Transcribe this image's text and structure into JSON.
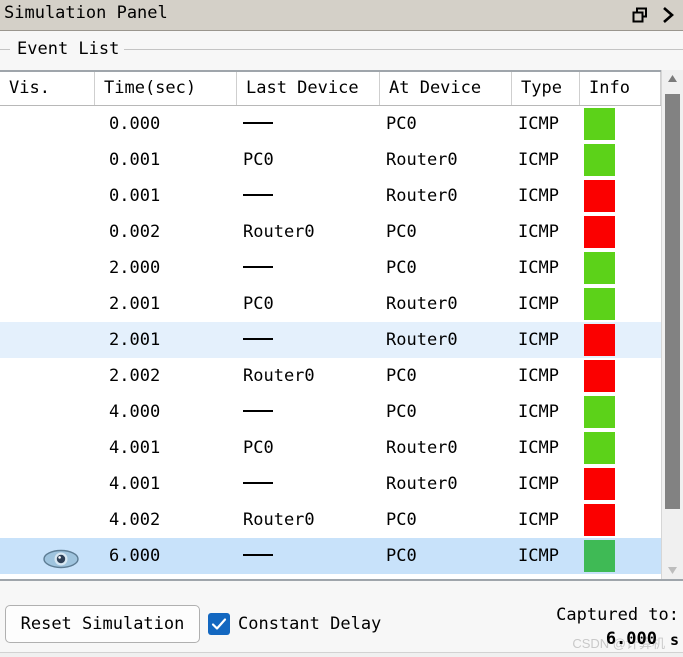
{
  "window": {
    "title": "Simulation Panel",
    "restore_icon": "restore-window-icon",
    "chevron_icon": "chevron-right-icon"
  },
  "group": {
    "legend": "Event List"
  },
  "table": {
    "columns": [
      {
        "key": "vis",
        "label": "Vis."
      },
      {
        "key": "time",
        "label": "Time(sec)"
      },
      {
        "key": "last",
        "label": "Last Device"
      },
      {
        "key": "at",
        "label": "At Device"
      },
      {
        "key": "type",
        "label": "Type"
      },
      {
        "key": "info",
        "label": "Info"
      }
    ],
    "rows": [
      {
        "vis": "",
        "time": "0.000",
        "last": "—",
        "at": "PC0",
        "type": "ICMP",
        "info_color": "#5CD219",
        "selected": "none"
      },
      {
        "vis": "",
        "time": "0.001",
        "last": "PC0",
        "at": "Router0",
        "type": "ICMP",
        "info_color": "#5CD219",
        "selected": "none"
      },
      {
        "vis": "",
        "time": "0.001",
        "last": "—",
        "at": "Router0",
        "type": "ICMP",
        "info_color": "#FB0000",
        "selected": "none"
      },
      {
        "vis": "",
        "time": "0.002",
        "last": "Router0",
        "at": "PC0",
        "type": "ICMP",
        "info_color": "#FB0000",
        "selected": "none"
      },
      {
        "vis": "",
        "time": "2.000",
        "last": "—",
        "at": "PC0",
        "type": "ICMP",
        "info_color": "#5CD219",
        "selected": "none"
      },
      {
        "vis": "",
        "time": "2.001",
        "last": "PC0",
        "at": "Router0",
        "type": "ICMP",
        "info_color": "#5CD219",
        "selected": "none"
      },
      {
        "vis": "",
        "time": "2.001",
        "last": "—",
        "at": "Router0",
        "type": "ICMP",
        "info_color": "#FB0000",
        "selected": "light"
      },
      {
        "vis": "",
        "time": "2.002",
        "last": "Router0",
        "at": "PC0",
        "type": "ICMP",
        "info_color": "#FB0000",
        "selected": "none"
      },
      {
        "vis": "",
        "time": "4.000",
        "last": "—",
        "at": "PC0",
        "type": "ICMP",
        "info_color": "#5CD219",
        "selected": "none"
      },
      {
        "vis": "",
        "time": "4.001",
        "last": "PC0",
        "at": "Router0",
        "type": "ICMP",
        "info_color": "#5CD219",
        "selected": "none"
      },
      {
        "vis": "",
        "time": "4.001",
        "last": "—",
        "at": "Router0",
        "type": "ICMP",
        "info_color": "#FB0000",
        "selected": "none"
      },
      {
        "vis": "",
        "time": "4.002",
        "last": "Router0",
        "at": "PC0",
        "type": "ICMP",
        "info_color": "#FB0000",
        "selected": "none"
      },
      {
        "vis": "eye-icon",
        "time": "6.000",
        "last": "—",
        "at": "PC0",
        "type": "ICMP",
        "info_color": "#3FBA55",
        "selected": "strong"
      }
    ]
  },
  "scrollbar": {
    "up_arrow_icon": "scroll-up-arrow-icon",
    "down_arrow_icon": "scroll-down-arrow-icon"
  },
  "footer": {
    "reset_button": "Reset Simulation",
    "constant_delay_label": "Constant Delay",
    "constant_delay_checked": true,
    "checkbox_icon": "checkmark-icon",
    "captured_label": "Captured to:",
    "captured_value": "6.000",
    "captured_unit": "s",
    "watermark": "CSDN @计算机"
  },
  "colors": {
    "titlebar_bg": "#D4D0C8",
    "row_select_light": "#E4F0FC",
    "row_select_strong": "#C8E2FA",
    "checkbox_blue": "#1367C0",
    "info_green": "#5CD219",
    "info_red": "#FB0000",
    "info_green_dark": "#3FBA55"
  }
}
